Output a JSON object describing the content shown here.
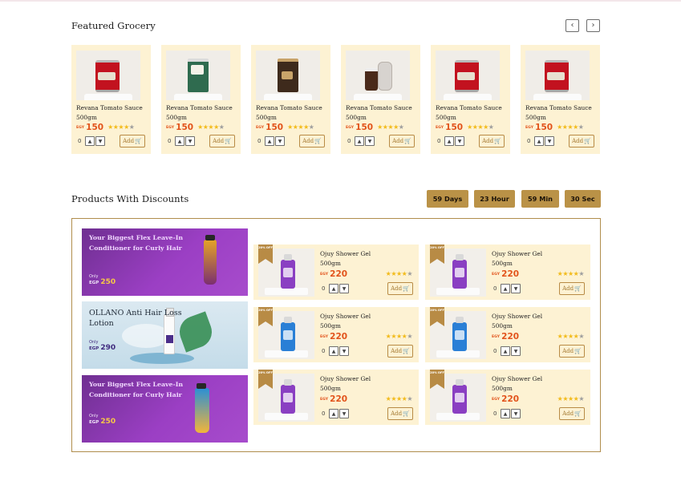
{
  "featured": {
    "title": "Featured Grocery",
    "prev_icon": "‹",
    "next_icon": "›",
    "products": [
      {
        "name": "Revana Tomato Sauce 500gm",
        "currency": "EGY",
        "price": "150",
        "rating": 4,
        "qty": "0",
        "add_label": "Add",
        "image": "tomato-can"
      },
      {
        "name": "Revana Tomato Sauce 500gm",
        "currency": "EGY",
        "price": "150",
        "rating": 4,
        "qty": "0",
        "add_label": "Add",
        "image": "white-pouch"
      },
      {
        "name": "Revana Tomato Sauce 500gm",
        "currency": "EGY",
        "price": "150",
        "rating": 4,
        "qty": "0",
        "add_label": "Add",
        "image": "coffee-bag"
      },
      {
        "name": "Revana Tomato Sauce 500gm",
        "currency": "EGY",
        "price": "150",
        "rating": 4,
        "qty": "0",
        "add_label": "Add",
        "image": "chocolate-jars"
      },
      {
        "name": "Revana Tomato Sauce 500gm",
        "currency": "EGY",
        "price": "150",
        "rating": 4,
        "qty": "0",
        "add_label": "Add",
        "image": "tomato-can"
      },
      {
        "name": "Revana Tomato Sauce 500gm",
        "currency": "EGY",
        "price": "150",
        "rating": 4,
        "qty": "0",
        "add_label": "Add",
        "image": "tomato-can"
      }
    ]
  },
  "discounts": {
    "title": "Products With Discounts",
    "countdown": [
      "59 Days",
      "23 Hour",
      "59 Min",
      "30 Sec"
    ],
    "banners": [
      {
        "title": "Your Biggest Flex Leave-In Conditioner for Curly Hair",
        "only": "Only",
        "currency": "EGP",
        "price": "250",
        "style": "purple"
      },
      {
        "title": "OLLANO Anti Hair Loss Lotion",
        "only": "Only",
        "currency": "EGP",
        "price": "290",
        "style": "blue"
      },
      {
        "title": "Your Biggest Flex Leave-In Conditioner for Curly Hair",
        "only": "Only",
        "currency": "EGP",
        "price": "250",
        "style": "purple"
      }
    ],
    "products": [
      {
        "badge": "20% OFF",
        "name": "Ojuy Shower Gel 500gm",
        "currency": "EGY",
        "price": "220",
        "rating": 4,
        "qty": "0",
        "add_label": "Add",
        "bottle_color": "#8a3fc2"
      },
      {
        "badge": "20% OFF",
        "name": "Ojuy Shower Gel 500gm",
        "currency": "EGY",
        "price": "220",
        "rating": 4,
        "qty": "0",
        "add_label": "Add",
        "bottle_color": "#8a3fc2"
      },
      {
        "badge": "20% OFF",
        "name": "Ojuy Shower Gel 500gm",
        "currency": "EGY",
        "price": "220",
        "rating": 4,
        "qty": "0",
        "add_label": "Add",
        "bottle_color": "#2a7fd6"
      },
      {
        "badge": "20% OFF",
        "name": "Ojuy Shower Gel 500gm",
        "currency": "EGY",
        "price": "220",
        "rating": 4,
        "qty": "0",
        "add_label": "Add",
        "bottle_color": "#2a7fd6"
      },
      {
        "badge": "20% OFF",
        "name": "Ojuy Shower Gel 500gm",
        "currency": "EGY",
        "price": "220",
        "rating": 4,
        "qty": "0",
        "add_label": "Add",
        "bottle_color": "#8a3fc2"
      },
      {
        "badge": "20% OFF",
        "name": "Ojuy Shower Gel 500gm",
        "currency": "EGY",
        "price": "220",
        "rating": 4,
        "qty": "0",
        "add_label": "Add",
        "bottle_color": "#8a3fc2"
      }
    ]
  },
  "colors": {
    "card_bg": "#fdf2d3",
    "accent_gold": "#ba9247",
    "price_orange": "#e2531b",
    "star_gold": "#f2bb1b"
  }
}
